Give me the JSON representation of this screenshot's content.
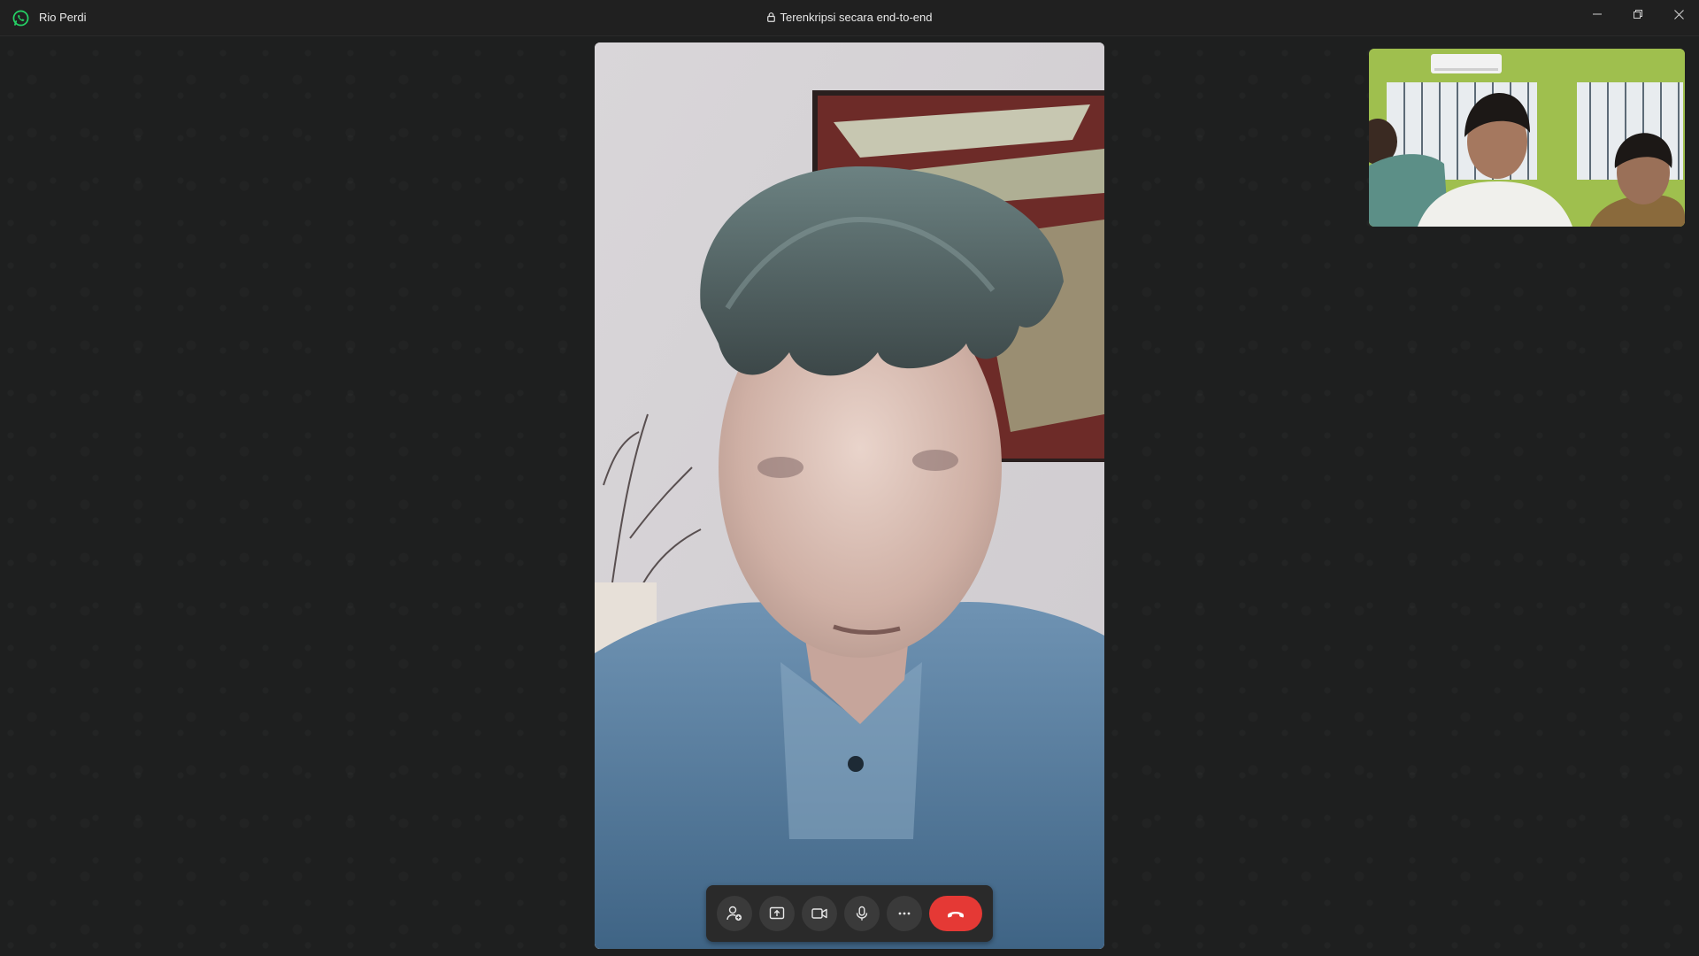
{
  "titlebar": {
    "caller_name": "Rio Perdi",
    "encryption_text": "Terenkripsi secara end-to-end"
  },
  "icons": {
    "app_logo": "whatsapp-icon",
    "lock": "lock-icon",
    "minimize": "minimize-icon",
    "maximize": "restore-icon",
    "close": "close-icon",
    "add_participant": "add-person-icon",
    "share_screen": "share-screen-icon",
    "video": "video-camera-icon",
    "mic": "microphone-icon",
    "more": "more-options-icon",
    "end_call": "end-call-icon"
  },
  "colors": {
    "accent": "#25d366",
    "end_call": "#e53935",
    "background": "#1e1f1f"
  }
}
